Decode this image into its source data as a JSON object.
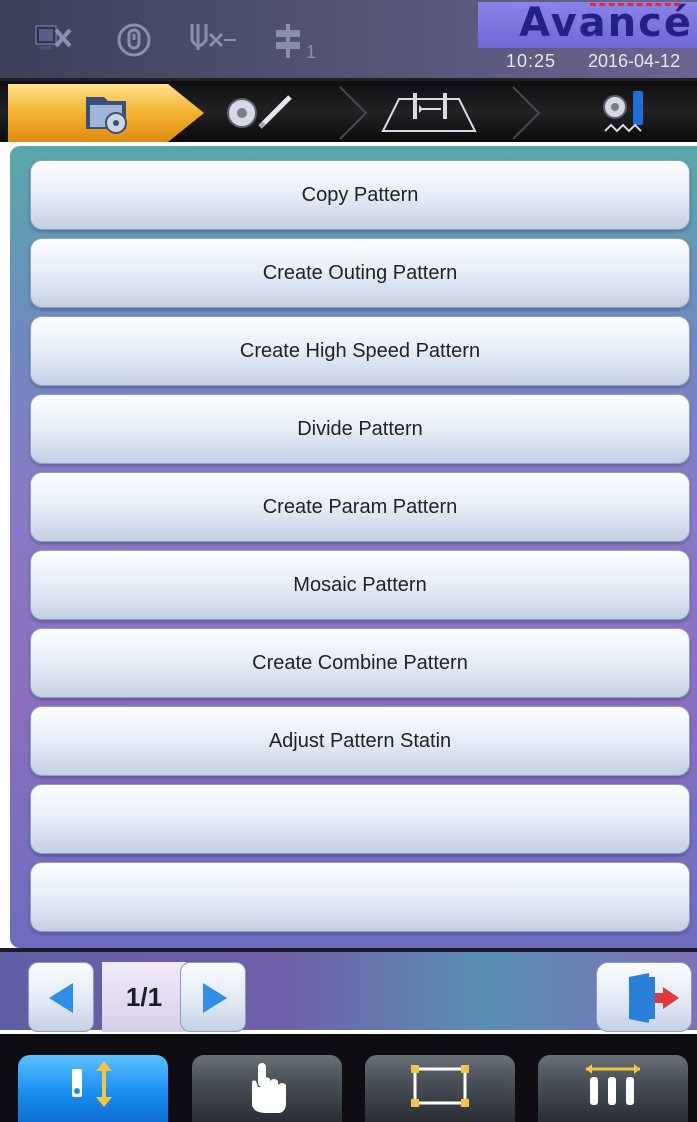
{
  "header": {
    "brand": "Avancé",
    "time": "10:25",
    "date": "2016-04-12",
    "status_icons": [
      "network-disconnected-icon",
      "rotation-lock-icon",
      "thread-break-icon",
      "needle-position-icon"
    ]
  },
  "tabs": [
    {
      "name": "file-manage-tab",
      "icon": "folder-flower-icon",
      "active": true
    },
    {
      "name": "pattern-edit-tab",
      "icon": "flower-pencil-icon",
      "active": false
    },
    {
      "name": "frame-tab",
      "icon": "frame-needle-icon",
      "active": false
    },
    {
      "name": "embroider-tab",
      "icon": "flower-needle-icon",
      "active": false
    }
  ],
  "menu": {
    "items": [
      "Copy Pattern",
      "Create Outing Pattern",
      "Create High Speed Pattern",
      "Divide Pattern",
      "Create Param Pattern",
      "Mosaic Pattern",
      "Create Combine Pattern",
      "Adjust Pattern Statin",
      "",
      ""
    ]
  },
  "pager": {
    "page": "1/1"
  },
  "bottom_nav": [
    {
      "name": "needle-move-icon",
      "active": true
    },
    {
      "name": "hand-pointer-icon",
      "active": false
    },
    {
      "name": "frame-rect-icon",
      "active": false
    },
    {
      "name": "needle-rack-icon",
      "active": false
    }
  ],
  "colors": {
    "accent": "#f2b430",
    "active_nav": "#1b8ff0",
    "brand_box": "#7a74e0",
    "brand_text": "#232087",
    "exit_red": "#e03a3a"
  }
}
